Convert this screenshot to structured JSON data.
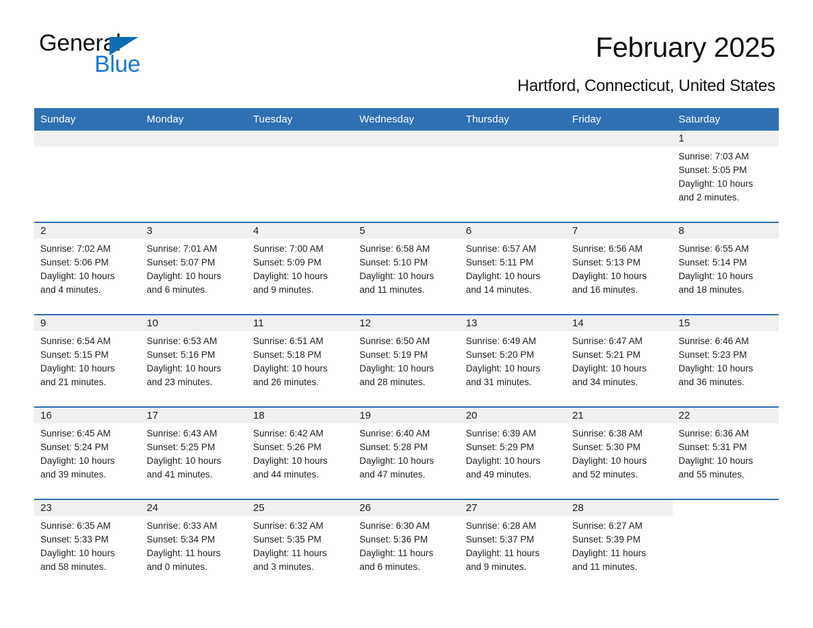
{
  "logo": {
    "word1": "General",
    "word2": "Blue",
    "triangle_color": "#0f6cb5",
    "blue_color": "#1878cf"
  },
  "header": {
    "title": "February 2025",
    "subtitle": "Hartford, Connecticut, United States",
    "header_bg": "#2f70b3",
    "daynum_bg": "#f0f0f0"
  },
  "weekdays": [
    "Sunday",
    "Monday",
    "Tuesday",
    "Wednesday",
    "Thursday",
    "Friday",
    "Saturday"
  ],
  "labels": {
    "sunrise": "Sunrise:",
    "sunset": "Sunset:",
    "daylight": "Daylight:"
  },
  "weeks": [
    [
      {
        "day": "",
        "blank": true
      },
      {
        "day": "",
        "blank": true
      },
      {
        "day": "",
        "blank": true
      },
      {
        "day": "",
        "blank": true
      },
      {
        "day": "",
        "blank": true
      },
      {
        "day": "",
        "blank": true
      },
      {
        "day": "1",
        "sunrise": "Sunrise: 7:03 AM",
        "sunset": "Sunset: 5:05 PM",
        "daylight1": "Daylight: 10 hours",
        "daylight2": "and 2 minutes."
      }
    ],
    [
      {
        "day": "2",
        "sunrise": "Sunrise: 7:02 AM",
        "sunset": "Sunset: 5:06 PM",
        "daylight1": "Daylight: 10 hours",
        "daylight2": "and 4 minutes."
      },
      {
        "day": "3",
        "sunrise": "Sunrise: 7:01 AM",
        "sunset": "Sunset: 5:07 PM",
        "daylight1": "Daylight: 10 hours",
        "daylight2": "and 6 minutes."
      },
      {
        "day": "4",
        "sunrise": "Sunrise: 7:00 AM",
        "sunset": "Sunset: 5:09 PM",
        "daylight1": "Daylight: 10 hours",
        "daylight2": "and 9 minutes."
      },
      {
        "day": "5",
        "sunrise": "Sunrise: 6:58 AM",
        "sunset": "Sunset: 5:10 PM",
        "daylight1": "Daylight: 10 hours",
        "daylight2": "and 11 minutes."
      },
      {
        "day": "6",
        "sunrise": "Sunrise: 6:57 AM",
        "sunset": "Sunset: 5:11 PM",
        "daylight1": "Daylight: 10 hours",
        "daylight2": "and 14 minutes."
      },
      {
        "day": "7",
        "sunrise": "Sunrise: 6:56 AM",
        "sunset": "Sunset: 5:13 PM",
        "daylight1": "Daylight: 10 hours",
        "daylight2": "and 16 minutes."
      },
      {
        "day": "8",
        "sunrise": "Sunrise: 6:55 AM",
        "sunset": "Sunset: 5:14 PM",
        "daylight1": "Daylight: 10 hours",
        "daylight2": "and 18 minutes."
      }
    ],
    [
      {
        "day": "9",
        "sunrise": "Sunrise: 6:54 AM",
        "sunset": "Sunset: 5:15 PM",
        "daylight1": "Daylight: 10 hours",
        "daylight2": "and 21 minutes."
      },
      {
        "day": "10",
        "sunrise": "Sunrise: 6:53 AM",
        "sunset": "Sunset: 5:16 PM",
        "daylight1": "Daylight: 10 hours",
        "daylight2": "and 23 minutes."
      },
      {
        "day": "11",
        "sunrise": "Sunrise: 6:51 AM",
        "sunset": "Sunset: 5:18 PM",
        "daylight1": "Daylight: 10 hours",
        "daylight2": "and 26 minutes."
      },
      {
        "day": "12",
        "sunrise": "Sunrise: 6:50 AM",
        "sunset": "Sunset: 5:19 PM",
        "daylight1": "Daylight: 10 hours",
        "daylight2": "and 28 minutes."
      },
      {
        "day": "13",
        "sunrise": "Sunrise: 6:49 AM",
        "sunset": "Sunset: 5:20 PM",
        "daylight1": "Daylight: 10 hours",
        "daylight2": "and 31 minutes."
      },
      {
        "day": "14",
        "sunrise": "Sunrise: 6:47 AM",
        "sunset": "Sunset: 5:21 PM",
        "daylight1": "Daylight: 10 hours",
        "daylight2": "and 34 minutes."
      },
      {
        "day": "15",
        "sunrise": "Sunrise: 6:46 AM",
        "sunset": "Sunset: 5:23 PM",
        "daylight1": "Daylight: 10 hours",
        "daylight2": "and 36 minutes."
      }
    ],
    [
      {
        "day": "16",
        "sunrise": "Sunrise: 6:45 AM",
        "sunset": "Sunset: 5:24 PM",
        "daylight1": "Daylight: 10 hours",
        "daylight2": "and 39 minutes."
      },
      {
        "day": "17",
        "sunrise": "Sunrise: 6:43 AM",
        "sunset": "Sunset: 5:25 PM",
        "daylight1": "Daylight: 10 hours",
        "daylight2": "and 41 minutes."
      },
      {
        "day": "18",
        "sunrise": "Sunrise: 6:42 AM",
        "sunset": "Sunset: 5:26 PM",
        "daylight1": "Daylight: 10 hours",
        "daylight2": "and 44 minutes."
      },
      {
        "day": "19",
        "sunrise": "Sunrise: 6:40 AM",
        "sunset": "Sunset: 5:28 PM",
        "daylight1": "Daylight: 10 hours",
        "daylight2": "and 47 minutes."
      },
      {
        "day": "20",
        "sunrise": "Sunrise: 6:39 AM",
        "sunset": "Sunset: 5:29 PM",
        "daylight1": "Daylight: 10 hours",
        "daylight2": "and 49 minutes."
      },
      {
        "day": "21",
        "sunrise": "Sunrise: 6:38 AM",
        "sunset": "Sunset: 5:30 PM",
        "daylight1": "Daylight: 10 hours",
        "daylight2": "and 52 minutes."
      },
      {
        "day": "22",
        "sunrise": "Sunrise: 6:36 AM",
        "sunset": "Sunset: 5:31 PM",
        "daylight1": "Daylight: 10 hours",
        "daylight2": "and 55 minutes."
      }
    ],
    [
      {
        "day": "23",
        "sunrise": "Sunrise: 6:35 AM",
        "sunset": "Sunset: 5:33 PM",
        "daylight1": "Daylight: 10 hours",
        "daylight2": "and 58 minutes."
      },
      {
        "day": "24",
        "sunrise": "Sunrise: 6:33 AM",
        "sunset": "Sunset: 5:34 PM",
        "daylight1": "Daylight: 11 hours",
        "daylight2": "and 0 minutes."
      },
      {
        "day": "25",
        "sunrise": "Sunrise: 6:32 AM",
        "sunset": "Sunset: 5:35 PM",
        "daylight1": "Daylight: 11 hours",
        "daylight2": "and 3 minutes."
      },
      {
        "day": "26",
        "sunrise": "Sunrise: 6:30 AM",
        "sunset": "Sunset: 5:36 PM",
        "daylight1": "Daylight: 11 hours",
        "daylight2": "and 6 minutes."
      },
      {
        "day": "27",
        "sunrise": "Sunrise: 6:28 AM",
        "sunset": "Sunset: 5:37 PM",
        "daylight1": "Daylight: 11 hours",
        "daylight2": "and 9 minutes."
      },
      {
        "day": "28",
        "sunrise": "Sunrise: 6:27 AM",
        "sunset": "Sunset: 5:39 PM",
        "daylight1": "Daylight: 11 hours",
        "daylight2": "and 11 minutes."
      },
      {
        "day": "",
        "blank": true,
        "noband": true
      }
    ]
  ]
}
